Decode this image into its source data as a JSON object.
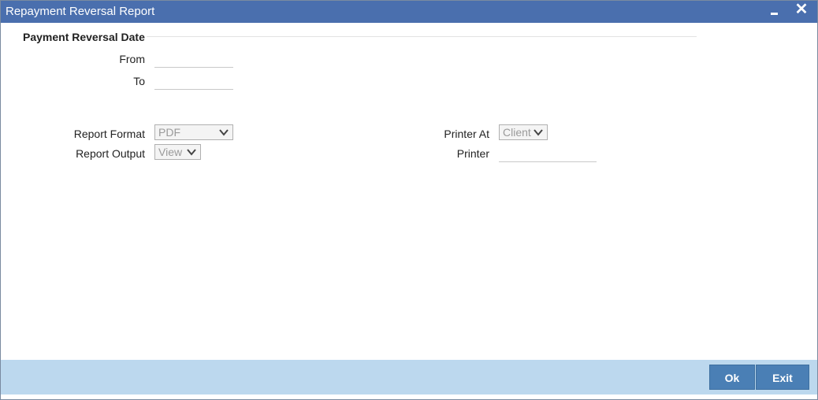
{
  "window": {
    "title": "Repayment Reversal Report"
  },
  "section": {
    "title": "Payment Reversal Date"
  },
  "fields": {
    "from_label": "From",
    "from_value": "",
    "to_label": "To",
    "to_value": "",
    "report_format_label": "Report Format",
    "report_format_value": "PDF",
    "report_output_label": "Report Output",
    "report_output_value": "View",
    "printer_at_label": "Printer At",
    "printer_at_value": "Client",
    "printer_label": "Printer",
    "printer_value": ""
  },
  "buttons": {
    "ok": "Ok",
    "exit": "Exit"
  },
  "icons": {
    "minimize": "minimize-icon",
    "close": "close-icon",
    "dropdown": "chevron-down-icon"
  },
  "colors": {
    "titlebar": "#4a6fae",
    "footer": "#bcd8ee",
    "button": "#4a7fb5"
  }
}
